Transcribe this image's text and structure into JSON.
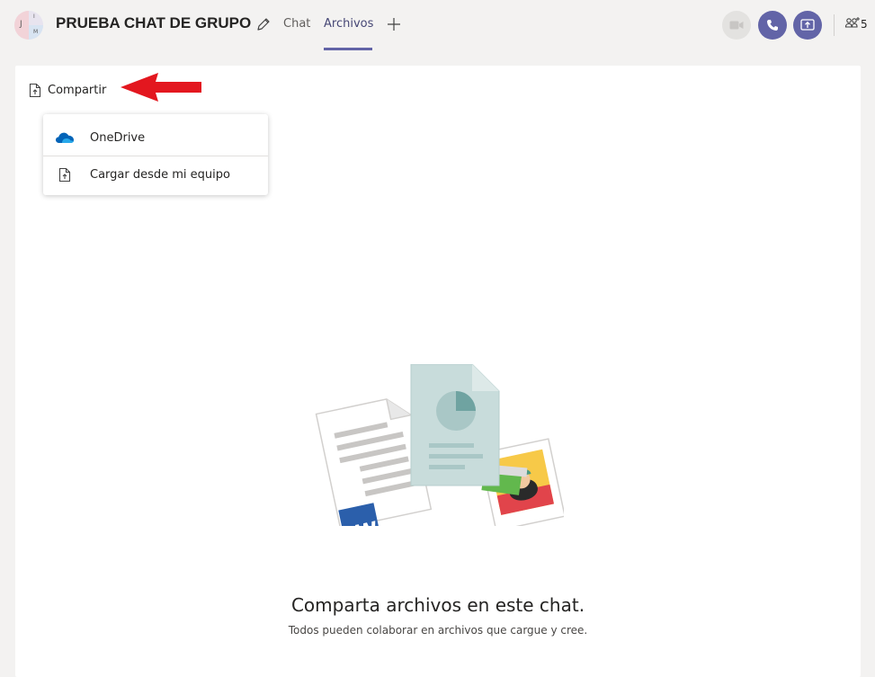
{
  "header": {
    "avatar_initials": [
      "J",
      "I",
      "M"
    ],
    "title": "PRUEBA CHAT DE GRUPO",
    "tabs": [
      {
        "label": "Chat",
        "active": false
      },
      {
        "label": "Archivos",
        "active": true
      }
    ],
    "participant_count": "5"
  },
  "toolbar": {
    "share_label": "Compartir"
  },
  "share_menu": {
    "items": [
      {
        "label": "OneDrive",
        "icon": "onedrive-icon"
      },
      {
        "label": "Cargar desde mi equipo",
        "icon": "upload-file-icon"
      }
    ]
  },
  "empty_state": {
    "title": "Comparta archivos en este chat.",
    "subtitle": "Todos pueden colaborar en archivos que cargue y cree."
  },
  "colors": {
    "accent": "#6264a7",
    "background": "#f3f2f1",
    "annotation_arrow": "#e3171f"
  }
}
